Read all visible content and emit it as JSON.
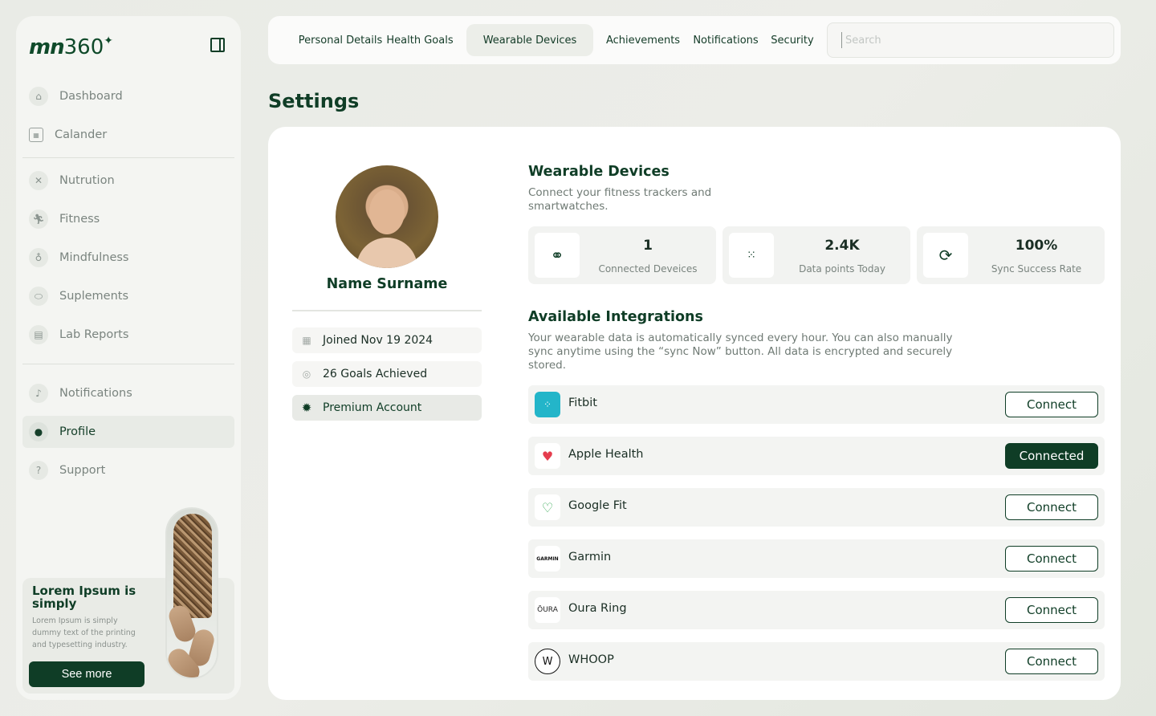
{
  "brand": {
    "logo_letters": "mn",
    "logo_number": "360"
  },
  "sidebar": {
    "items": [
      {
        "label": "Dashboard",
        "icon": "home-icon"
      },
      {
        "label": "Calander",
        "icon": "calendar-icon"
      },
      {
        "label": "Nutrution",
        "icon": "utensils-icon"
      },
      {
        "label": "Fitness",
        "icon": "running-icon"
      },
      {
        "label": "Mindfulness",
        "icon": "meditation-icon"
      },
      {
        "label": "Suplements",
        "icon": "pills-icon"
      },
      {
        "label": "Lab Reports",
        "icon": "report-icon"
      },
      {
        "label": "Notifications",
        "icon": "bell-icon"
      },
      {
        "label": "Profile",
        "icon": "user-icon",
        "active": true
      },
      {
        "label": "Support",
        "icon": "help-icon"
      }
    ],
    "promo": {
      "title": "Lorem Ipsum is simply",
      "text": "Lorem Ipsum is simply dummy text of the printing and typesetting industry.",
      "button": "See more"
    }
  },
  "tabs": [
    {
      "label": "Personal Details"
    },
    {
      "label": "Health Goals"
    },
    {
      "label": "Wearable Devices",
      "active": true
    },
    {
      "label": "Achievements"
    },
    {
      "label": "Notifications"
    },
    {
      "label": "Security"
    }
  ],
  "search": {
    "placeholder": "Search"
  },
  "page_title": "Settings",
  "profile": {
    "name": "Name Surname",
    "stats": [
      {
        "text": "Joined Nov 19 2024",
        "icon": "calendar-icon"
      },
      {
        "text": "26 Goals Achieved",
        "icon": "target-icon"
      },
      {
        "text": "Premium Account",
        "icon": "badge-icon"
      }
    ]
  },
  "wearables": {
    "title": "Wearable Devices",
    "description": "Connect your fitness trackers and smartwatches.",
    "metrics": [
      {
        "value": "1",
        "label": "Connected Deveices",
        "icon": "devices-icon"
      },
      {
        "value": "2.4K",
        "label": "Data points Today",
        "icon": "dots-grid-icon"
      },
      {
        "value": "100%",
        "label": "Sync Success Rate",
        "icon": "sync-icon"
      }
    ]
  },
  "integrations": {
    "title": "Available Integrations",
    "description": "Your wearable data is automatically synced every hour. You can also manually sync anytime using the “sync Now” button. All data is encrypted and securely stored.",
    "items": [
      {
        "name": "Fitbit",
        "button": "Connect",
        "connected": false,
        "icon": "fitbit-icon"
      },
      {
        "name": "Apple Health",
        "button": "Connected",
        "connected": true,
        "icon": "heart-icon"
      },
      {
        "name": "Google Fit",
        "button": "Connect",
        "connected": false,
        "icon": "google-fit-icon"
      },
      {
        "name": "Garmin",
        "button": "Connect",
        "connected": false,
        "icon": "garmin-icon",
        "icon_text": "GARMIN"
      },
      {
        "name": "Oura Ring",
        "button": "Connect",
        "connected": false,
        "icon": "oura-icon",
        "icon_text": "ŌURA"
      },
      {
        "name": "WHOOP",
        "button": "Connect",
        "connected": false,
        "icon": "whoop-icon"
      }
    ]
  }
}
